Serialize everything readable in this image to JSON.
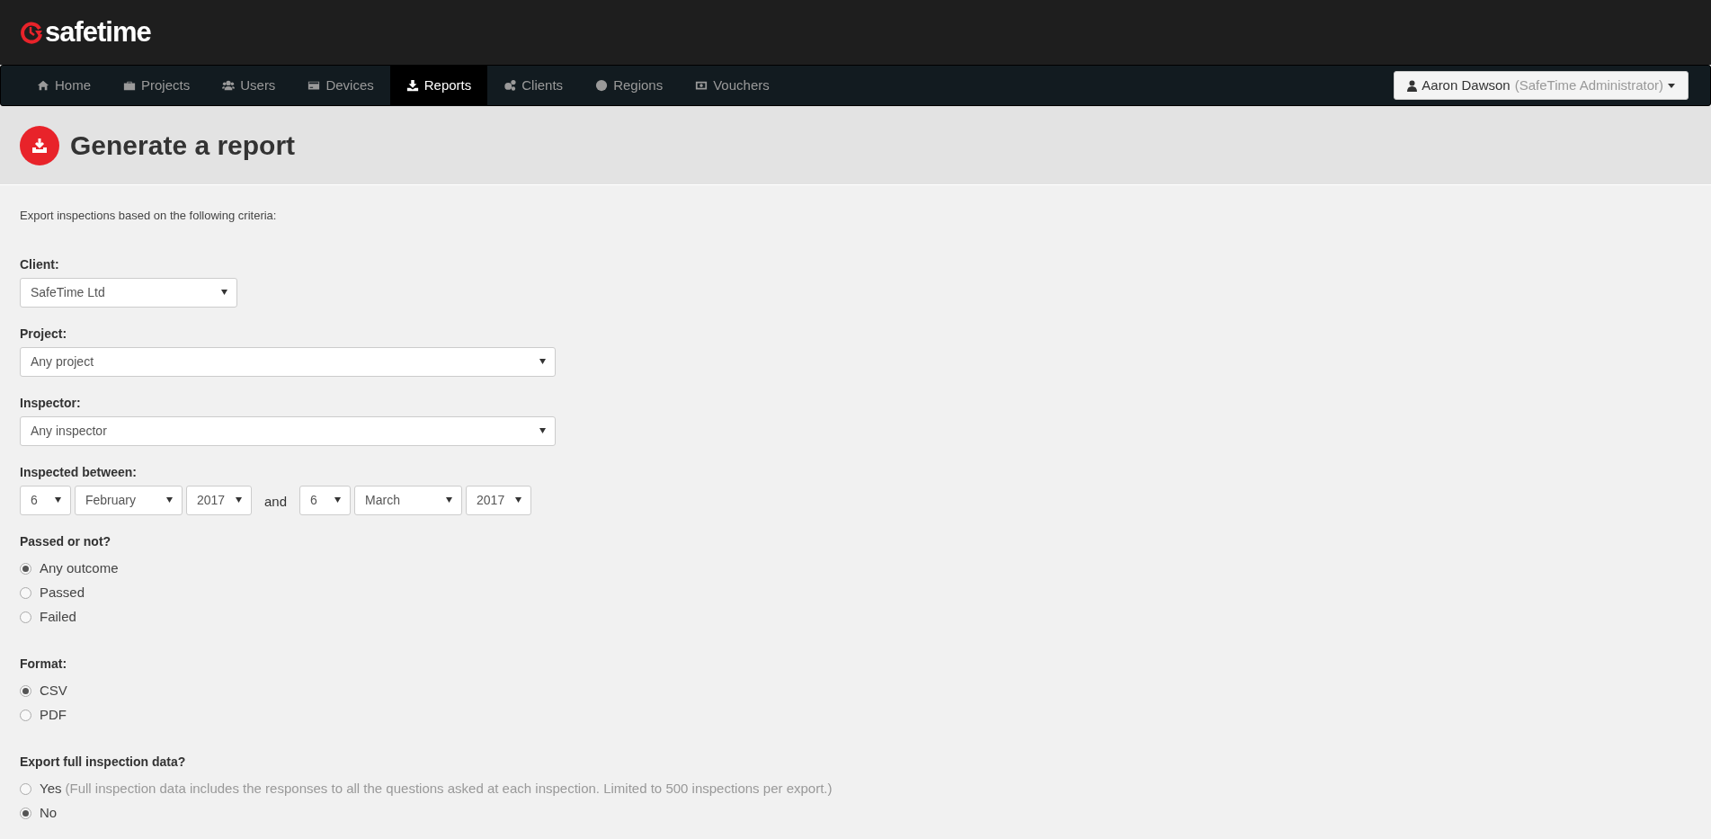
{
  "logo": {
    "text": "safetime"
  },
  "nav": {
    "items": [
      {
        "label": "Home",
        "selected": false
      },
      {
        "label": "Projects",
        "selected": false
      },
      {
        "label": "Users",
        "selected": false
      },
      {
        "label": "Devices",
        "selected": false
      },
      {
        "label": "Reports",
        "selected": true
      },
      {
        "label": "Clients",
        "selected": false
      },
      {
        "label": "Regions",
        "selected": false
      },
      {
        "label": "Vouchers",
        "selected": false
      }
    ],
    "user_menu": {
      "name": "Aaron Dawson",
      "role": "(SafeTime Administrator)"
    }
  },
  "page_title": "Generate a report",
  "intro": "Export inspections based on the following criteria:",
  "fields": [
    {
      "label": "Client:",
      "value": "SafeTime Ltd"
    },
    {
      "label": "Project:",
      "value": "Any project"
    },
    {
      "label": "Inspector:",
      "value": "Any inspector"
    }
  ],
  "date_range": {
    "label": "Inspected between:",
    "from": [
      "6",
      "February",
      "2017"
    ],
    "joiner": "and",
    "to": [
      "6",
      "March",
      "2017"
    ]
  },
  "radio_groups": [
    {
      "label": "Passed or not?",
      "options": [
        {
          "label": "Any outcome",
          "selected": true
        },
        {
          "label": "Passed",
          "selected": false
        },
        {
          "label": "Failed",
          "selected": false
        }
      ]
    },
    {
      "label": "Format:",
      "options": [
        {
          "label": "CSV",
          "selected": true
        },
        {
          "label": "PDF",
          "selected": false
        }
      ]
    },
    {
      "label": "Export full inspection data?",
      "options": [
        {
          "label": "Yes",
          "note": "(Full inspection data includes the responses to all the questions asked at each inspection. Limited to 500 inspections per export.)",
          "selected": false
        },
        {
          "label": "No",
          "selected": true
        }
      ]
    }
  ]
}
